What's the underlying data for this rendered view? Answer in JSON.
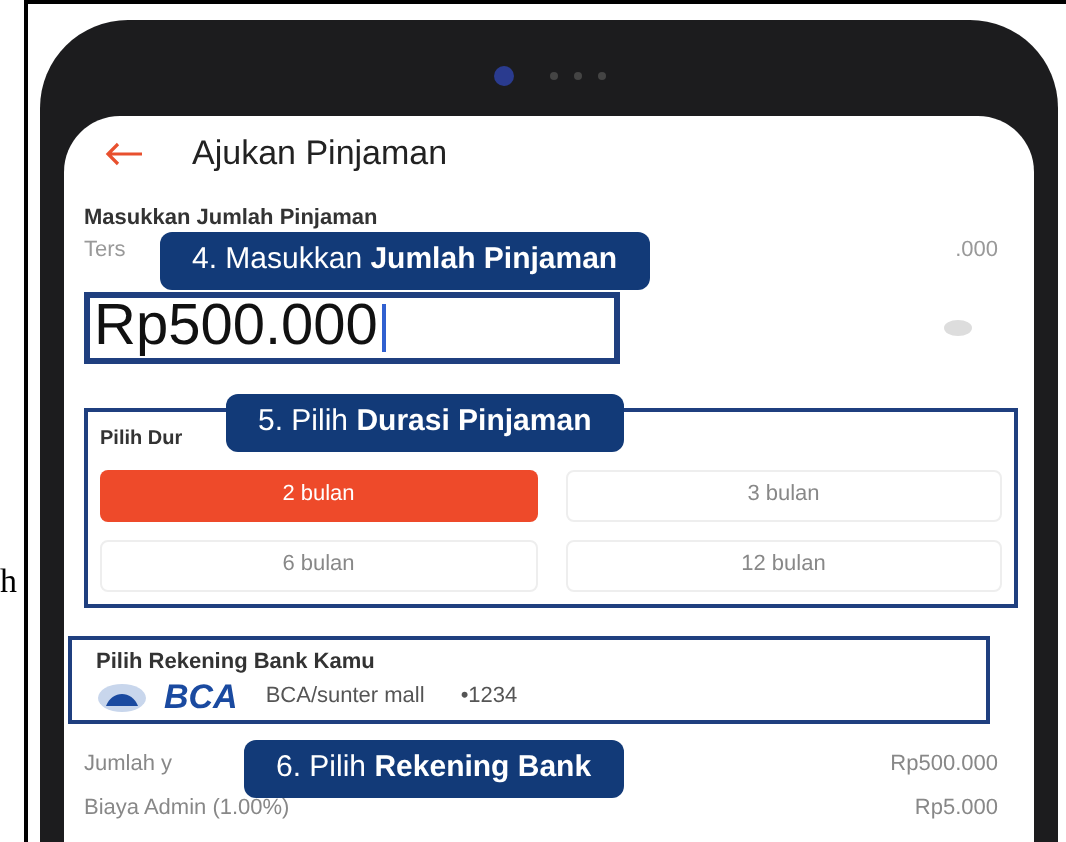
{
  "stray_text": "h",
  "header": {
    "title": "Ajukan Pinjaman"
  },
  "amount_section": {
    "label": "Masukkan Jumlah Pinjaman",
    "hint_left": "Ters",
    "hint_right": ".000",
    "value": "Rp500.000"
  },
  "duration": {
    "label": "Pilih Dur",
    "options": [
      {
        "label": "2 bulan",
        "selected": true
      },
      {
        "label": "3 bulan",
        "selected": false
      },
      {
        "label": "6 bulan",
        "selected": false
      },
      {
        "label": "12 bulan",
        "selected": false
      }
    ]
  },
  "bank": {
    "label": "Pilih Rekening Bank Kamu",
    "logo_text": "BCA",
    "account": "BCA/sunter mall",
    "number": "•1234"
  },
  "summary": [
    {
      "label": "Jumlah y",
      "value": "Rp500.000"
    },
    {
      "label": "Biaya Admin (1.00%)",
      "value": "Rp5.000"
    }
  ],
  "callouts": [
    {
      "text": "4. Masukkan **Jumlah Pinjaman**"
    },
    {
      "text": "5. Pilih **Durasi Pinjaman**"
    },
    {
      "text": "6. Pilih **Rekening Bank**"
    }
  ]
}
